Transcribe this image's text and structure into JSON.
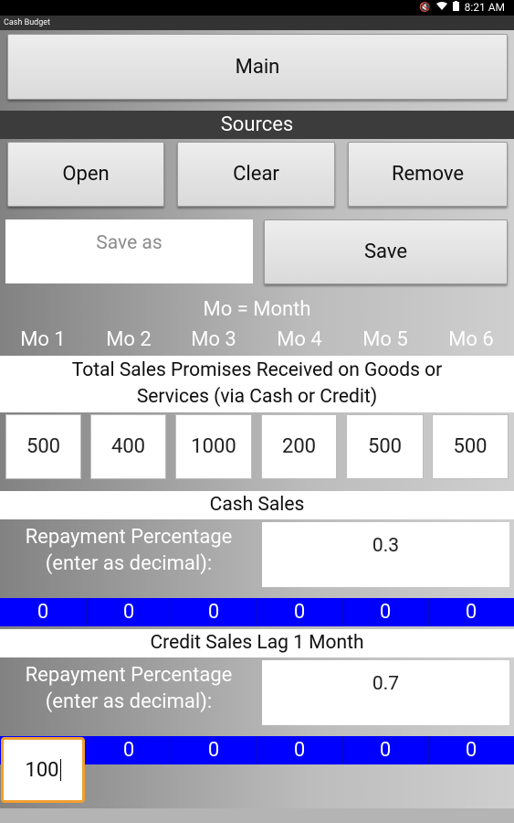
{
  "status": {
    "time": "8:21 AM",
    "icons": [
      "mute-icon",
      "wifi-icon",
      "battery-icon"
    ]
  },
  "app": {
    "title": "Cash Budget"
  },
  "main_button": "Main",
  "sources": {
    "header": "Sources",
    "open": "Open",
    "clear": "Clear",
    "remove": "Remove",
    "save_as_placeholder": "Save as",
    "save": "Save"
  },
  "months": {
    "legend": "Mo = Month",
    "labels": [
      "Mo 1",
      "Mo 2",
      "Mo 3",
      "Mo 4",
      "Mo 5",
      "Mo 6"
    ]
  },
  "total_sales": {
    "title_line1": "Total Sales Promises Received on Goods or",
    "title_line2": "Services (via Cash or Credit)",
    "values": [
      "500",
      "400",
      "1000",
      "200",
      "500",
      "500"
    ]
  },
  "cash_sales": {
    "title": "Cash Sales",
    "label_line1": "Repayment Percentage",
    "label_line2": "(enter as decimal):",
    "rate": "0.3",
    "results": [
      "0",
      "0",
      "0",
      "0",
      "0",
      "0"
    ]
  },
  "credit_lag1": {
    "title": "Credit Sales Lag 1 Month",
    "label_line1": "Repayment Percentage",
    "label_line2": "(enter as decimal):",
    "rate": "0.7",
    "first_input": "100",
    "results": [
      "0",
      "0",
      "0",
      "0",
      "0"
    ]
  },
  "colors": {
    "result_bar": "#0000ff",
    "focus_outline": "#f0a030",
    "section_header": "#3c3c3c"
  }
}
